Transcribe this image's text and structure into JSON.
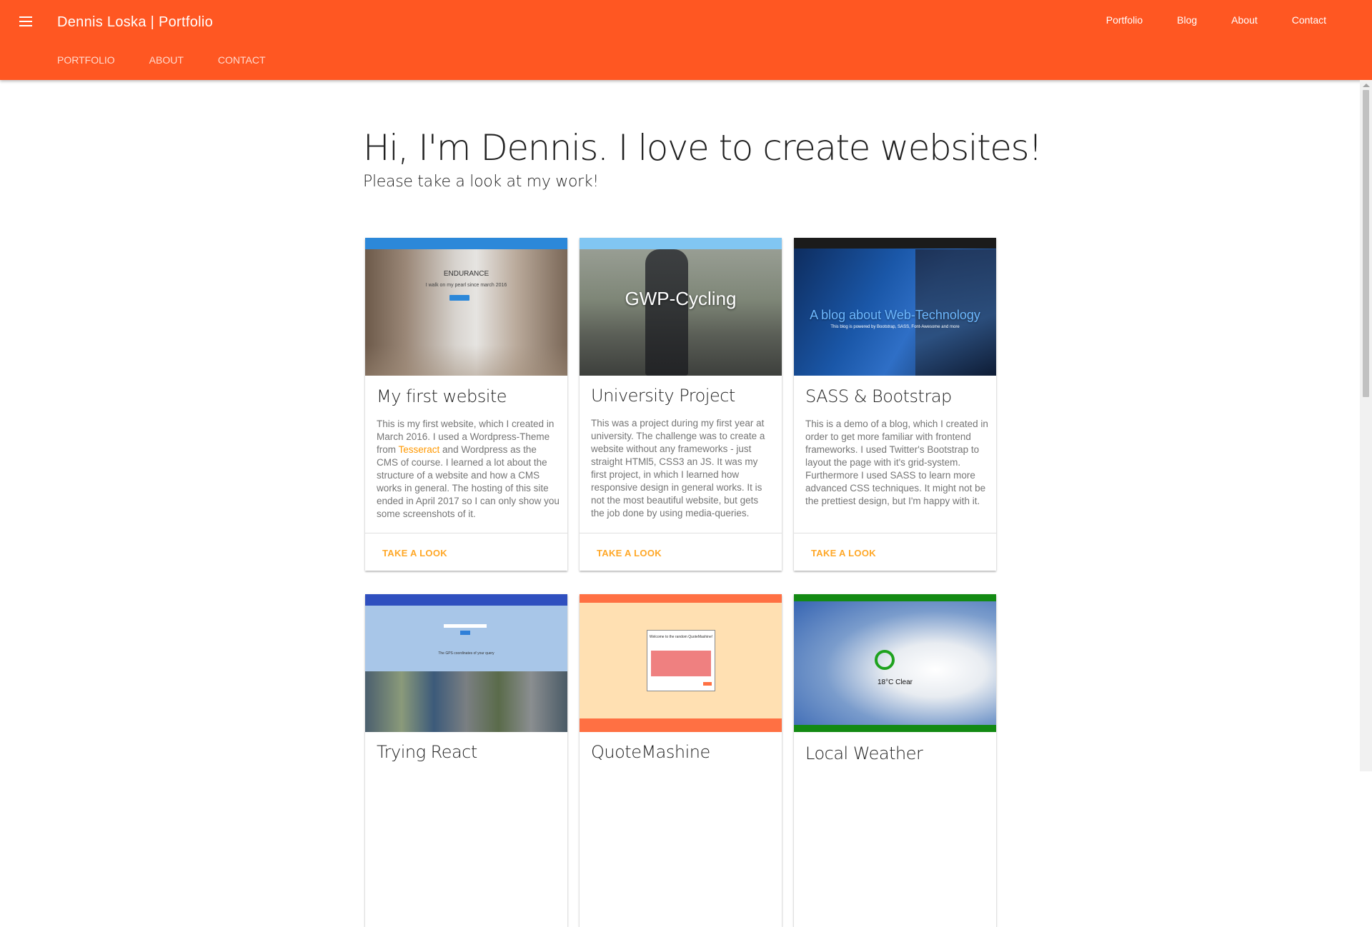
{
  "header": {
    "brand": "Dennis Loska | Portfolio",
    "nav": [
      "Portfolio",
      "Blog",
      "About",
      "Contact"
    ],
    "tabs": [
      "PORTFOLIO",
      "ABOUT",
      "CONTACT"
    ]
  },
  "hero": {
    "title": "Hi, I'm Dennis. I love to create websites!",
    "subtitle": "Please take a look at my work!"
  },
  "cards": [
    {
      "title": "My first website",
      "text_before": "This is my first website, which I created in March 2016. I used a Wordpress-Theme from ",
      "link": "Tesseract",
      "text_after": " and Wordpress as the CMS of course. I learned a lot about the structure of a website and how a CMS works in general. The hosting of this site ended in April 2017 so I can only show you some screenshots of it.",
      "action": "TAKE A LOOK",
      "shot_title": "ENDURANCE",
      "shot_sub": "I walk on my pearl since march 2016"
    },
    {
      "title": "University Project",
      "text": "This was a project during my first year at university. The challenge was to create a website without any frameworks - just straight HTMl5, CSS3 an JS. It was my first project, in which I learned how responsive design in general works. It is not the most beautiful website, but gets the job done by using media-queries.",
      "action": "TAKE A LOOK",
      "shot_title": "GWP-Cycling"
    },
    {
      "title": "SASS & Bootstrap",
      "text": "This is a demo of a blog, which I created in order to get more familiar with frontend frameworks. I used Twitter's Bootstrap to layout the page with it's grid-system. Furthermore I used SASS to learn more advanced CSS techniques. It might not be the prettiest design, but I'm happy with it.",
      "action": "TAKE A LOOK",
      "shot_title": "A blog about Web-Technology",
      "shot_sub": "This blog is powered by Bootstrap, SASS, Font-Awesome and more"
    },
    {
      "title": "Trying React",
      "shot_caption": "The GPS coordinates of your query"
    },
    {
      "title": "QuoteMashine",
      "shot_text": "Welcome to the random QuoteMashine!"
    },
    {
      "title": "Local Weather",
      "shot_text": "18°C Clear"
    }
  ],
  "colors": {
    "primary": "#ff5722",
    "accent": "#ffa726"
  }
}
